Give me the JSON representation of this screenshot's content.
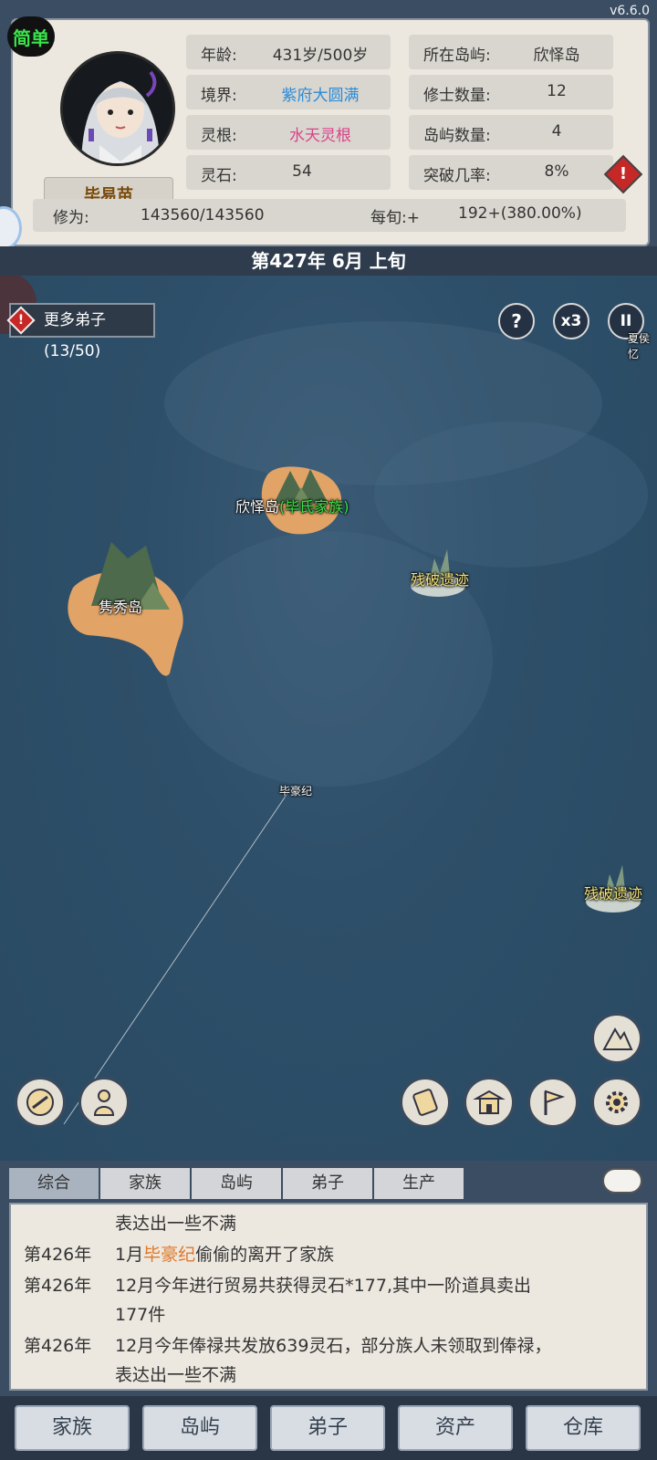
{
  "version": "v6.6.0",
  "difficulty_badge": "简单",
  "character": {
    "name": "毕易苗",
    "age_label": "年龄:",
    "age_value": "431岁/500岁",
    "realm_label": "境界:",
    "realm_value": "紫府大圆满",
    "root_label": "灵根:",
    "root_value": "水天灵根",
    "stones_label": "灵石:",
    "stones_value": "54",
    "island_label": "所在岛屿:",
    "island_value": "欣怿岛",
    "cultivators_label": "修士数量:",
    "cultivators_value": "12",
    "islands_label": "岛屿数量:",
    "islands_value": "4",
    "breakthrough_label": "突破几率:",
    "breakthrough_value": "8%",
    "xiuwei_label": "修为:",
    "xiuwei_value": "143560/143560",
    "per_period_label": "每旬:+",
    "per_period_value": "192+(380.00%)"
  },
  "date": "第427年 6月 上旬",
  "map": {
    "more_disciples": "更多弟子(13/50)",
    "help_glyph": "?",
    "speed_label": "x3",
    "pause_glyph": "II",
    "edge_label": "夏侯忆",
    "island_main_name": "欣怿岛",
    "island_main_family": "(毕氏家族)",
    "island_west": "隽秀岛",
    "ruin_1": "残破遗迹",
    "ruin_2": "残破遗迹",
    "traveler": "毕豪纪"
  },
  "log_tabs": [
    "综合",
    "家族",
    "岛屿",
    "弟子",
    "生产"
  ],
  "log": {
    "line0_text": "表达出一些不满",
    "line1_year": "第426年",
    "line1_pre": "1月",
    "line1_name": "毕豪纪",
    "line1_post": "偷偷的离开了家族",
    "line2_year": "第426年",
    "line2_text": "12月今年进行贸易共获得灵石*177,其中一阶道具卖出",
    "line2_cont": "177件",
    "line3_year": "第426年",
    "line3_text": "12月今年俸禄共发放639灵石，部分族人未领取到俸禄，",
    "line3_cont": "表达出一些不满"
  },
  "bottom_nav": [
    "家族",
    "岛屿",
    "弟子",
    "资产",
    "仓库"
  ],
  "colors": {
    "sea": "#2e4f69",
    "panel": "#ece8e0",
    "realm_blue": "#2a8bd8",
    "root_pink": "#d9438a",
    "family_green": "#38e44a",
    "ruin_yellow": "#f3e27a",
    "highlight_orange": "#e0782a"
  }
}
